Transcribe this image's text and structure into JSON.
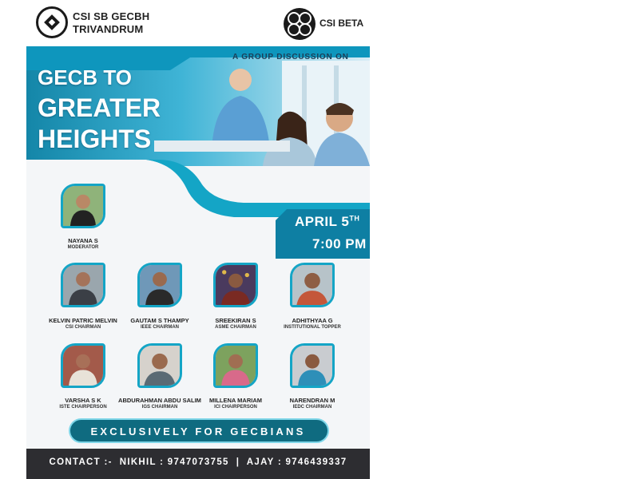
{
  "header": {
    "org_line1": "CSI SB GECBH",
    "org_line2": "TRIVANDRUM",
    "partner_label": "CSI BETA"
  },
  "hero": {
    "announcement": "A GROUP DISCUSSION ON",
    "title_line1": "GECB TO",
    "title_line2": "GREATER",
    "title_line3": "HEIGHTS"
  },
  "schedule": {
    "date_day": "APRIL 5",
    "date_suffix": "TH",
    "time": "7:00 PM"
  },
  "moderator": {
    "name": "NAYANA S",
    "role": "MODERATOR"
  },
  "panelists": [
    {
      "name": "KELVIN PATRIC MELVIN",
      "role": "CSI CHAIRMAN"
    },
    {
      "name": "GAUTAM S THAMPY",
      "role": "IEEE CHAIRMAN"
    },
    {
      "name": "SREEKIRAN S",
      "role": "ASME CHAIRMAN"
    },
    {
      "name": "ADHITHYAA G",
      "role": "INSTITUTIONAL TOPPER"
    },
    {
      "name": "VARSHA S K",
      "role": "ISTE CHAIRPERSON"
    },
    {
      "name": "ABDURAHMAN ABDU SALIM",
      "role": "IGS CHAIRMAN"
    },
    {
      "name": "MILLENA MARIAM",
      "role": "ICI CHAIRPERSON"
    },
    {
      "name": "NARENDRAN M",
      "role": "IEDC CHAIRMAN"
    }
  ],
  "banner": {
    "text": "EXCLUSIVELY FOR GECBIANS"
  },
  "footer": {
    "contact": "CONTACT :-  NIKHIL : 9747073755  |  AJAY : 9746439337"
  },
  "icons": [
    "csi-emblem-icon",
    "csi-beta-logo-icon",
    "person-photo-icon"
  ],
  "colors": {
    "accent": "#14a5c6",
    "dark": "#2d2d31",
    "banner": "#0f6b80"
  }
}
